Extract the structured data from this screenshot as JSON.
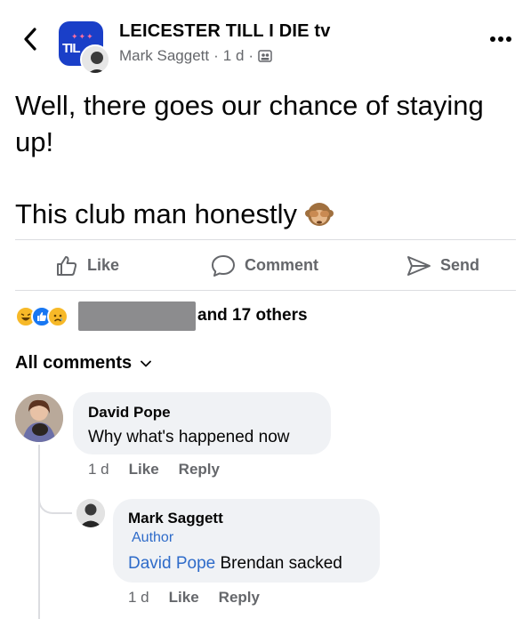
{
  "post": {
    "group_name": "LEICESTER TILL I DIE tv",
    "group_avatar_text": "TIL",
    "author": "Mark Saggett",
    "separator": "·",
    "time": "1 d",
    "text_line1": "Well, there goes our chance of staying up!",
    "text_line2": "This club man honestly",
    "emoji": "see-no-evil-monkey"
  },
  "actions": {
    "like": "Like",
    "comment": "Comment",
    "send": "Send"
  },
  "reactions": {
    "types": [
      "haha",
      "like",
      "sad"
    ],
    "count_text": "and 17 others"
  },
  "comments_filter": "All comments",
  "comments": [
    {
      "name": "David Pope",
      "text": "Why what's happened now",
      "time": "1 d",
      "like_label": "Like",
      "reply_label": "Reply"
    }
  ],
  "reply": {
    "name": "Mark Saggett",
    "badge": "Author",
    "mention": "David Pope",
    "text": " Brendan sacked",
    "time": "1 d",
    "like_label": "Like",
    "reply_label": "Reply"
  },
  "colors": {
    "accent_blue": "#1877f2",
    "mention_blue": "#2e6bc9",
    "muted_text": "#65676b",
    "bubble_bg": "#f0f2f5"
  }
}
